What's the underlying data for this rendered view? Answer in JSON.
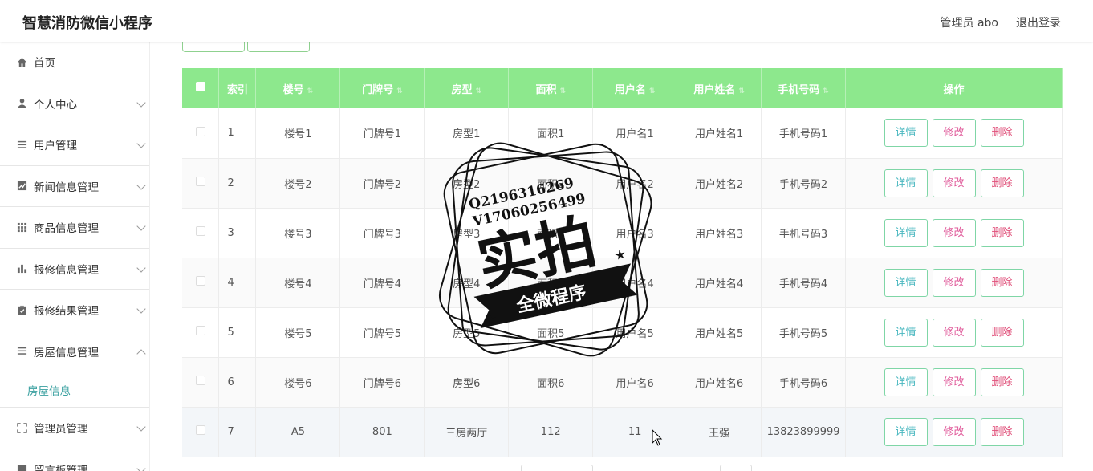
{
  "app": {
    "title": "智慧消防微信小程序",
    "user": "管理员 abo",
    "logout": "退出登录"
  },
  "sidebar": {
    "items": [
      {
        "label": "首页",
        "icon": "home-icon",
        "chevron": false
      },
      {
        "label": "个人中心",
        "icon": "user-icon",
        "chevron": true
      },
      {
        "label": "用户管理",
        "icon": "list-icon",
        "chevron": true
      },
      {
        "label": "新闻信息管理",
        "icon": "chart-line-icon",
        "chevron": true
      },
      {
        "label": "商品信息管理",
        "icon": "grid-icon",
        "chevron": true
      },
      {
        "label": "报修信息管理",
        "icon": "bar-chart-icon",
        "chevron": true
      },
      {
        "label": "报修结果管理",
        "icon": "clipboard-icon",
        "chevron": true
      },
      {
        "label": "房屋信息管理",
        "icon": "list-icon",
        "chevron": true,
        "expanded": true
      }
    ],
    "sub_item": "房屋信息",
    "items_after": [
      {
        "label": "管理员管理",
        "icon": "fullscreen-icon",
        "chevron": true
      },
      {
        "label": "留言板管理",
        "icon": "message-icon",
        "chevron": true
      }
    ]
  },
  "table": {
    "headers": [
      "索引",
      "楼号",
      "门牌号",
      "房型",
      "面积",
      "用户名",
      "用户姓名",
      "手机号码",
      "操作"
    ],
    "rows": [
      {
        "idx": "1",
        "building": "楼号1",
        "door": "门牌号1",
        "type": "房型1",
        "area": "面积1",
        "username": "用户名1",
        "name": "用户姓名1",
        "phone": "手机号码1"
      },
      {
        "idx": "2",
        "building": "楼号2",
        "door": "门牌号2",
        "type": "房型2",
        "area": "面积2",
        "username": "用户名2",
        "name": "用户姓名2",
        "phone": "手机号码2"
      },
      {
        "idx": "3",
        "building": "楼号3",
        "door": "门牌号3",
        "type": "房型3",
        "area": "面积3",
        "username": "用户名3",
        "name": "用户姓名3",
        "phone": "手机号码3"
      },
      {
        "idx": "4",
        "building": "楼号4",
        "door": "门牌号4",
        "type": "房型4",
        "area": "面积4",
        "username": "用户名4",
        "name": "用户姓名4",
        "phone": "手机号码4"
      },
      {
        "idx": "5",
        "building": "楼号5",
        "door": "门牌号5",
        "type": "房型5",
        "area": "面积5",
        "username": "用户名5",
        "name": "用户姓名5",
        "phone": "手机号码5"
      },
      {
        "idx": "6",
        "building": "楼号6",
        "door": "门牌号6",
        "type": "房型6",
        "area": "面积6",
        "username": "用户名6",
        "name": "用户姓名6",
        "phone": "手机号码6"
      },
      {
        "idx": "7",
        "building": "A5",
        "door": "801",
        "type": "三房两厅",
        "area": "112",
        "username": "11",
        "name": "王强",
        "phone": "13823899999"
      }
    ],
    "actions": {
      "detail": "详情",
      "edit": "修改",
      "delete": "删除"
    }
  },
  "watermark": {
    "line1": "Q2196316269",
    "line2": "V17060256499",
    "big": "实拍",
    "banner": "全微程序"
  },
  "colors": {
    "header_green": "#8de88d",
    "accent_teal": "#3aa0a0"
  }
}
